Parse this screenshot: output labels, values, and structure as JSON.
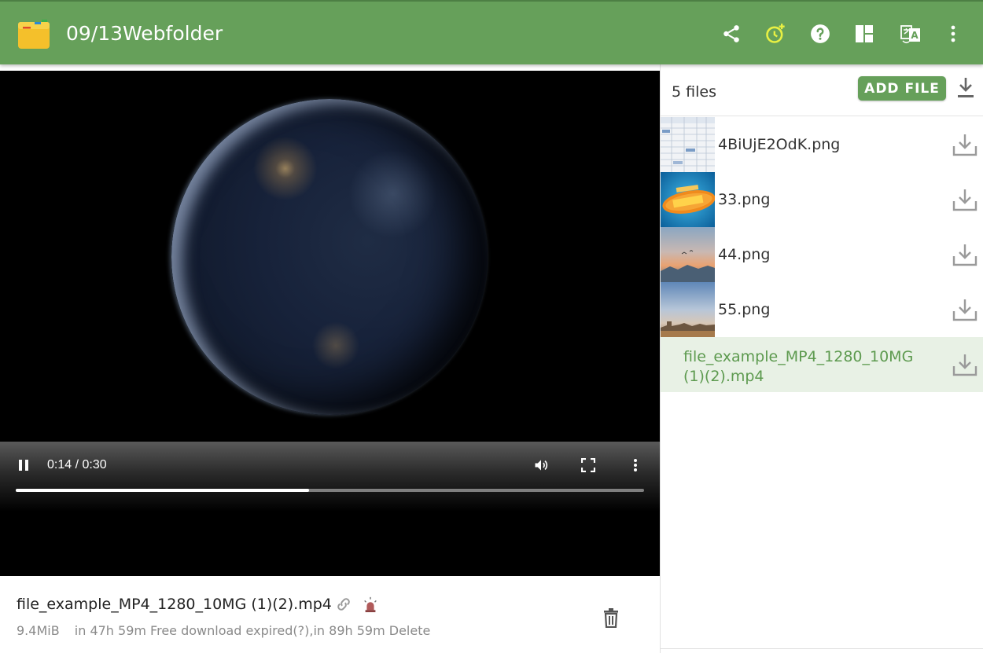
{
  "header": {
    "title": "09/13Webfolder",
    "bg_color": "#66a05a",
    "icons": [
      "folder-icon",
      "share-icon",
      "add-timer-icon",
      "help-icon",
      "layout-icon",
      "translate-icon",
      "more-vert-icon"
    ],
    "timer_icon_color": "#e8f043"
  },
  "player": {
    "time": "0:14 / 0:30",
    "progress_fraction": 0.4667,
    "icons": [
      "pause-icon",
      "volume-icon",
      "fullscreen-icon",
      "more-vert-icon"
    ]
  },
  "current_file": {
    "name": "file_example_MP4_1280_10MG (1)(2).mp4",
    "size": "9.4MiB",
    "expiry_text": "in 47h 59m Free download expired(?),in 89h 59m Delete",
    "icons": [
      "link-icon",
      "alarm-light-icon",
      "trash-icon"
    ]
  },
  "panel": {
    "files_count": "5 files",
    "add_file_label": "ADD FILE",
    "files": [
      {
        "name": "4BiUjE2OdK.png",
        "thumb": "spreadsheet-thumb"
      },
      {
        "name": "33.png",
        "thumb": "cartoon-logo-thumb"
      },
      {
        "name": "44.png",
        "thumb": "sunset-sky-thumb"
      },
      {
        "name": "55.png",
        "thumb": "city-haze-thumb"
      },
      {
        "name": "file_example_MP4_1280_10MG (1)(2).mp4",
        "thumb": "",
        "active": true
      }
    ],
    "accent_color": "#5d9a4f",
    "active_bg": "#e8f1e5"
  }
}
